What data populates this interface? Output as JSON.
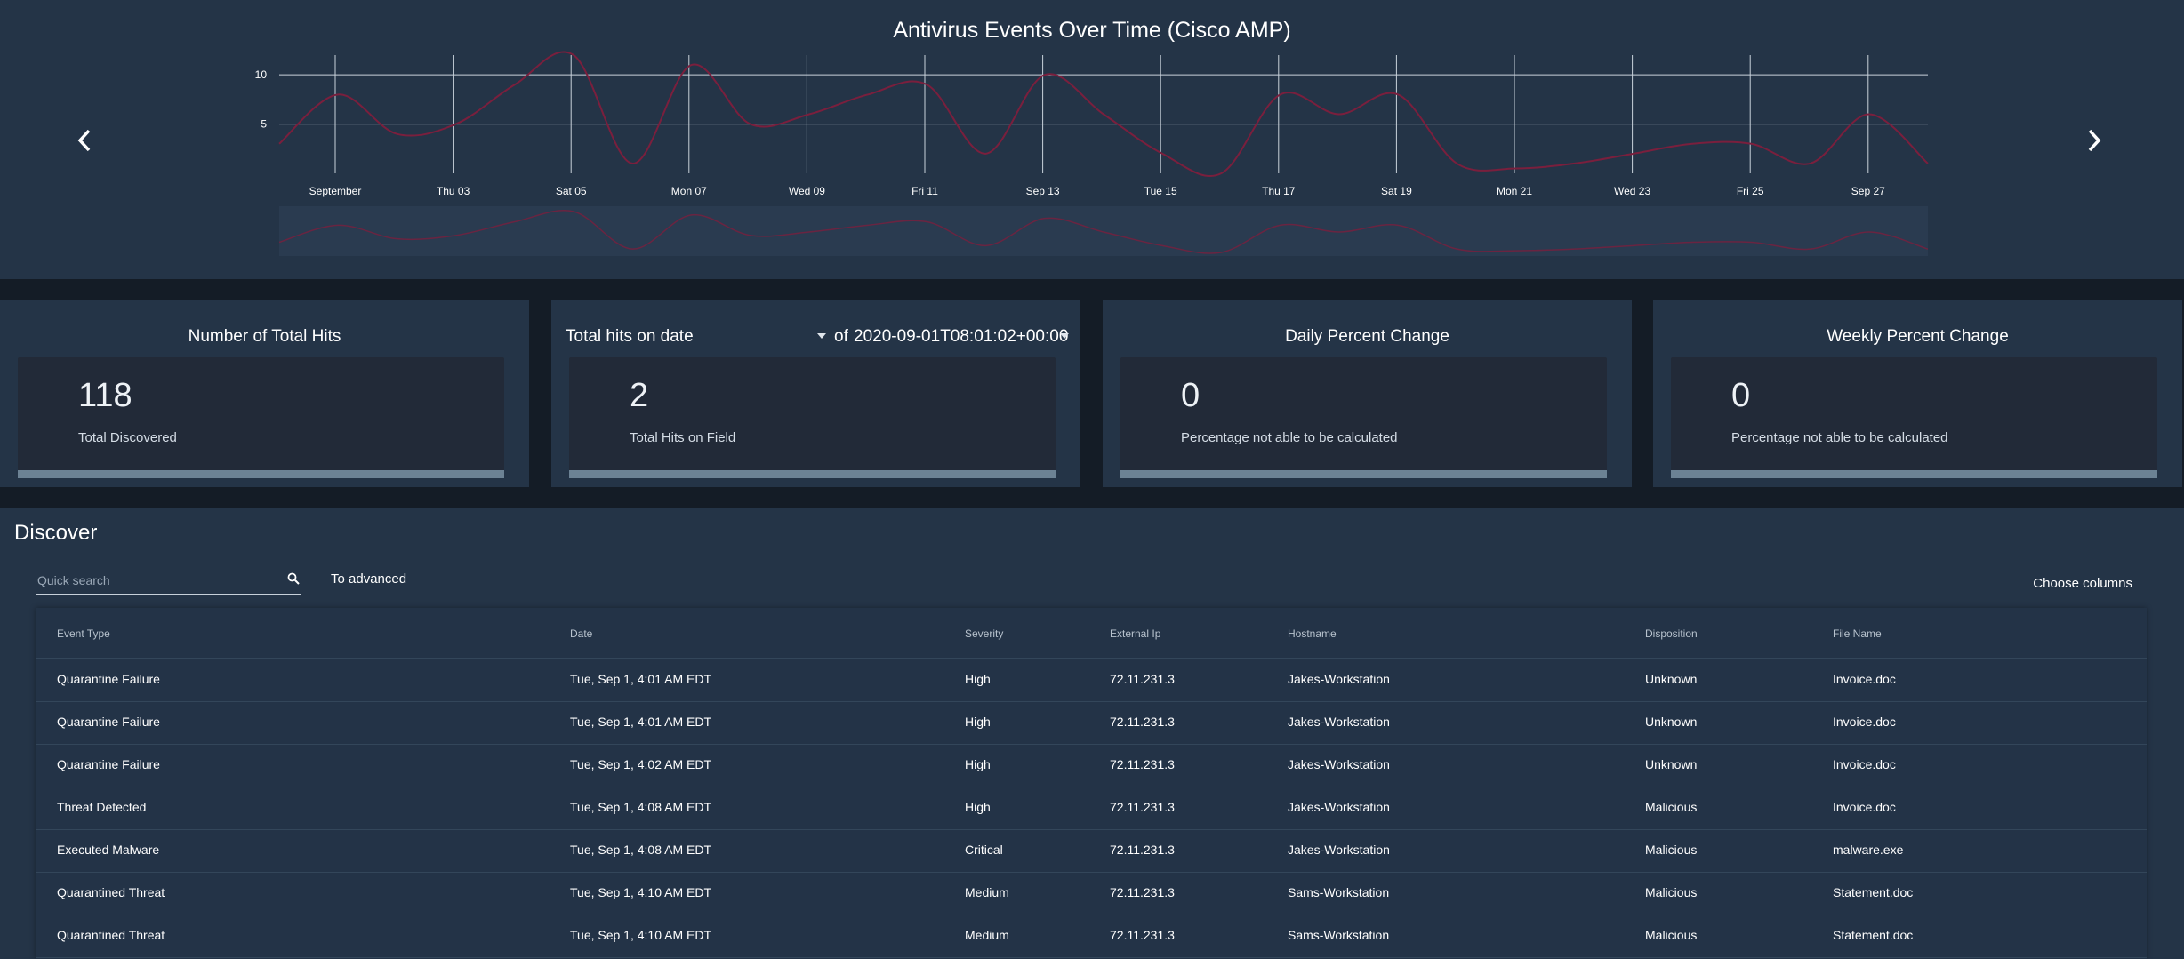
{
  "chart_data": {
    "type": "line",
    "title": "Antivirus Events Over Time (Cisco AMP)",
    "x_tick_labels": [
      "September",
      "Thu 03",
      "Sat 05",
      "Mon 07",
      "Wed 09",
      "Fri 11",
      "Sep 13",
      "Tue 15",
      "Thu 17",
      "Sat 19",
      "Mon 21",
      "Wed 23",
      "Fri 25",
      "Sep 27"
    ],
    "y_tick_labels": [
      "10",
      "5"
    ],
    "ylim": [
      0,
      12
    ],
    "grid": true,
    "series": [
      {
        "color": "#7a1f3d",
        "x": [
          0,
          1,
          2,
          3,
          4,
          5,
          6,
          7,
          8,
          9,
          10,
          11,
          12,
          13,
          14,
          15,
          16,
          17,
          18,
          19,
          20,
          21,
          22,
          23,
          24,
          25,
          26,
          27,
          28
        ],
        "values": [
          3,
          8,
          4,
          5,
          9,
          12,
          1,
          11,
          5,
          6,
          8,
          9,
          2,
          10,
          6,
          2,
          0,
          8,
          6,
          8,
          1,
          0.5,
          1,
          2,
          3,
          3,
          1,
          6,
          1
        ]
      }
    ],
    "navigator": true
  },
  "nav": {
    "prev_icon": "chevron-left-icon",
    "next_icon": "chevron-right-icon"
  },
  "cards": [
    {
      "title": "Number of Total Hits",
      "value": "118",
      "sub": "Total Discovered"
    },
    {
      "title": "Total hits on date",
      "of_label": "of",
      "date_value": "2020-09-01T08:01:02+00:00",
      "value": "2",
      "sub": "Total Hits on Field"
    },
    {
      "title": "Daily Percent Change",
      "value": "0",
      "sub": "Percentage not able to be calculated"
    },
    {
      "title": "Weekly Percent Change",
      "value": "0",
      "sub": "Percentage not able to be calculated"
    }
  ],
  "discover": {
    "title": "Discover",
    "search_placeholder": "Quick search",
    "to_advanced": "To advanced",
    "choose_columns": "Choose columns",
    "columns": [
      "Event Type",
      "Date",
      "Severity",
      "External Ip",
      "Hostname",
      "Disposition",
      "File Name"
    ],
    "rows": [
      [
        "Quarantine Failure",
        "Tue, Sep 1, 4:01 AM EDT",
        "High",
        "72.11.231.3",
        "Jakes-Workstation",
        "Unknown",
        "Invoice.doc"
      ],
      [
        "Quarantine Failure",
        "Tue, Sep 1, 4:01 AM EDT",
        "High",
        "72.11.231.3",
        "Jakes-Workstation",
        "Unknown",
        "Invoice.doc"
      ],
      [
        "Quarantine Failure",
        "Tue, Sep 1, 4:02 AM EDT",
        "High",
        "72.11.231.3",
        "Jakes-Workstation",
        "Unknown",
        "Invoice.doc"
      ],
      [
        "Threat Detected",
        "Tue, Sep 1, 4:08 AM EDT",
        "High",
        "72.11.231.3",
        "Jakes-Workstation",
        "Malicious",
        "Invoice.doc"
      ],
      [
        "Executed Malware",
        "Tue, Sep 1, 4:08 AM EDT",
        "Critical",
        "72.11.231.3",
        "Jakes-Workstation",
        "Malicious",
        "malware.exe"
      ],
      [
        "Quarantined Threat",
        "Tue, Sep 1, 4:10 AM EDT",
        "Medium",
        "72.11.231.3",
        "Sams-Workstation",
        "Malicious",
        "Statement.doc"
      ],
      [
        "Quarantined Threat",
        "Tue, Sep 1, 4:10 AM EDT",
        "Medium",
        "72.11.231.3",
        "Sams-Workstation",
        "Malicious",
        "Statement.doc"
      ]
    ]
  }
}
